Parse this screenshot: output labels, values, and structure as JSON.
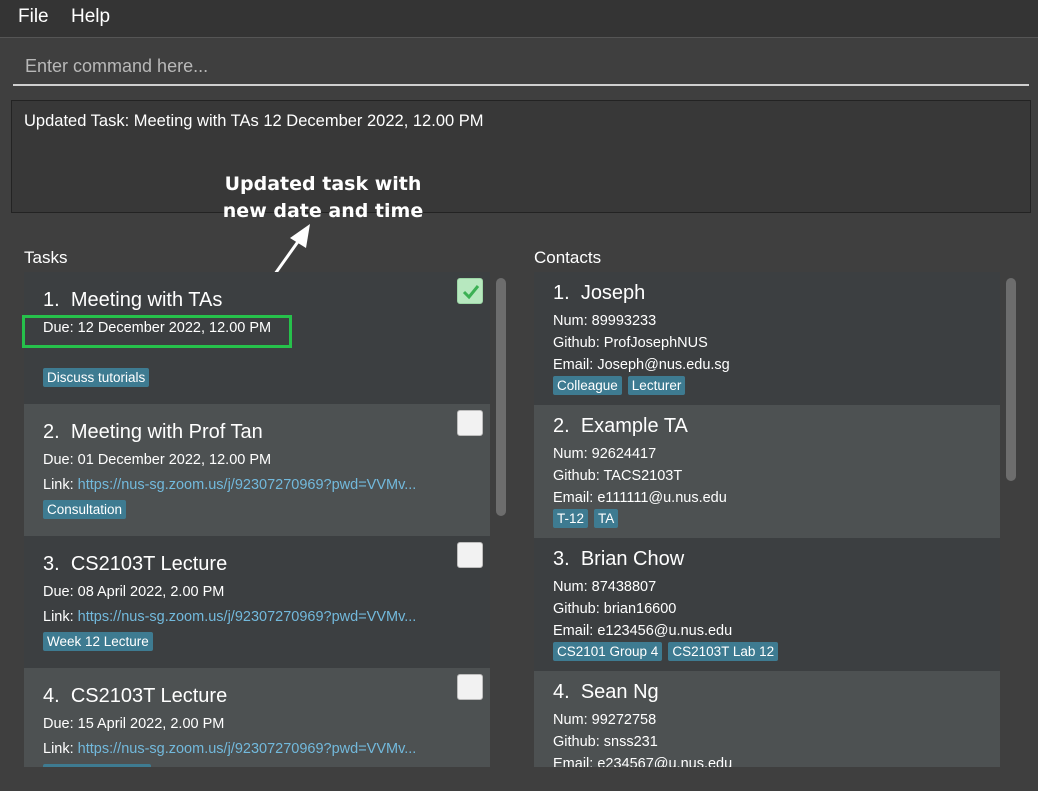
{
  "menu": {
    "file": "File",
    "help": "Help"
  },
  "command": {
    "placeholder": "Enter command here..."
  },
  "result": {
    "text": "Updated Task: Meeting with TAs 12 December 2022, 12.00 PM"
  },
  "annotation": {
    "line1": "Updated task with",
    "line2": "new date and time"
  },
  "tasks": {
    "label": "Tasks",
    "items": [
      {
        "index": "1.",
        "title": "Meeting with TAs",
        "due": "Due: 12 December 2022, 12.00 PM",
        "link_label": "",
        "link": "",
        "tags": [
          "Discuss tutorials"
        ],
        "done": true
      },
      {
        "index": "2.",
        "title": "Meeting with Prof Tan",
        "due": "Due: 01 December 2022, 12.00 PM",
        "link_label": "Link:",
        "link": "https://nus-sg.zoom.us/j/92307270969?pwd=VVMv...",
        "tags": [
          "Consultation"
        ],
        "done": false
      },
      {
        "index": "3.",
        "title": "CS2103T Lecture",
        "due": "Due: 08 April 2022, 2.00 PM",
        "link_label": "Link:",
        "link": "https://nus-sg.zoom.us/j/92307270969?pwd=VVMv...",
        "tags": [
          "Week 12 Lecture"
        ],
        "done": false
      },
      {
        "index": "4.",
        "title": "CS2103T Lecture",
        "due": "Due: 15 April 2022, 2.00 PM",
        "link_label": "Link:",
        "link": "https://nus-sg.zoom.us/j/92307270969?pwd=VVMv...",
        "tags": [
          ""
        ],
        "done": false
      }
    ]
  },
  "contacts": {
    "label": "Contacts",
    "items": [
      {
        "index": "1.",
        "name": "Joseph",
        "num": "Num: 89993233",
        "github": "Github: ProfJosephNUS",
        "email": "Email: Joseph@nus.edu.sg",
        "tags": [
          "Colleague",
          "Lecturer"
        ]
      },
      {
        "index": "2.",
        "name": "Example TA",
        "num": "Num: 92624417",
        "github": "Github: TACS2103T",
        "email": "Email: e111111@u.nus.edu",
        "tags": [
          "T-12",
          "TA"
        ]
      },
      {
        "index": "3.",
        "name": "Brian Chow",
        "num": "Num: 87438807",
        "github": "Github: brian16600",
        "email": "Email: e123456@u.nus.edu",
        "tags": [
          "CS2101 Group 4",
          "CS2103T Lab 12"
        ]
      },
      {
        "index": "4.",
        "name": "Sean Ng",
        "num": "Num: 99272758",
        "github": "Github: snss231",
        "email": "Email: e234567@u.nus.edu",
        "tags": []
      }
    ]
  },
  "colors": {
    "tag": "#3e7b91",
    "link": "#72b9dc",
    "highlight": "#26c14b",
    "check": "#3cb054"
  }
}
